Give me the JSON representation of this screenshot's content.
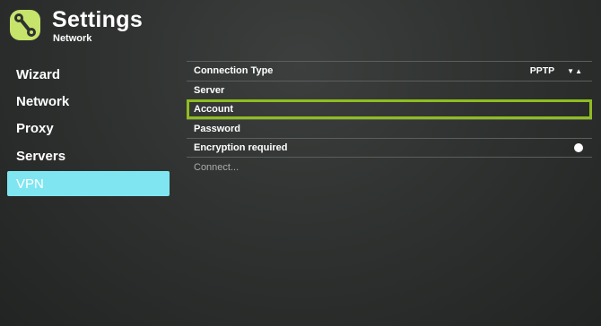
{
  "header": {
    "title": "Settings",
    "subtitle": "Network",
    "logo_icon": "plex-style-logo-icon"
  },
  "sidebar": {
    "items": [
      {
        "label": "Wizard",
        "active": false
      },
      {
        "label": "Network",
        "active": false
      },
      {
        "label": "Proxy",
        "active": false
      },
      {
        "label": "Servers",
        "active": false
      },
      {
        "label": "VPN",
        "active": true
      }
    ]
  },
  "settings": {
    "connection_type": {
      "label": "Connection Type",
      "value": "PPTP",
      "icon": "up-down-chevron-icon"
    },
    "server": {
      "label": "Server"
    },
    "account": {
      "label": "Account",
      "focused": true
    },
    "password": {
      "label": "Password"
    },
    "encryption": {
      "label": "Encryption required",
      "enabled": false,
      "icon": "toggle-circle-icon"
    },
    "connect": {
      "label": "Connect..."
    }
  },
  "colors": {
    "accent_active": "#7fe6f1",
    "focus_outline": "#8fbd1f",
    "logo": "#c6e36b",
    "background": "#2f3230"
  }
}
